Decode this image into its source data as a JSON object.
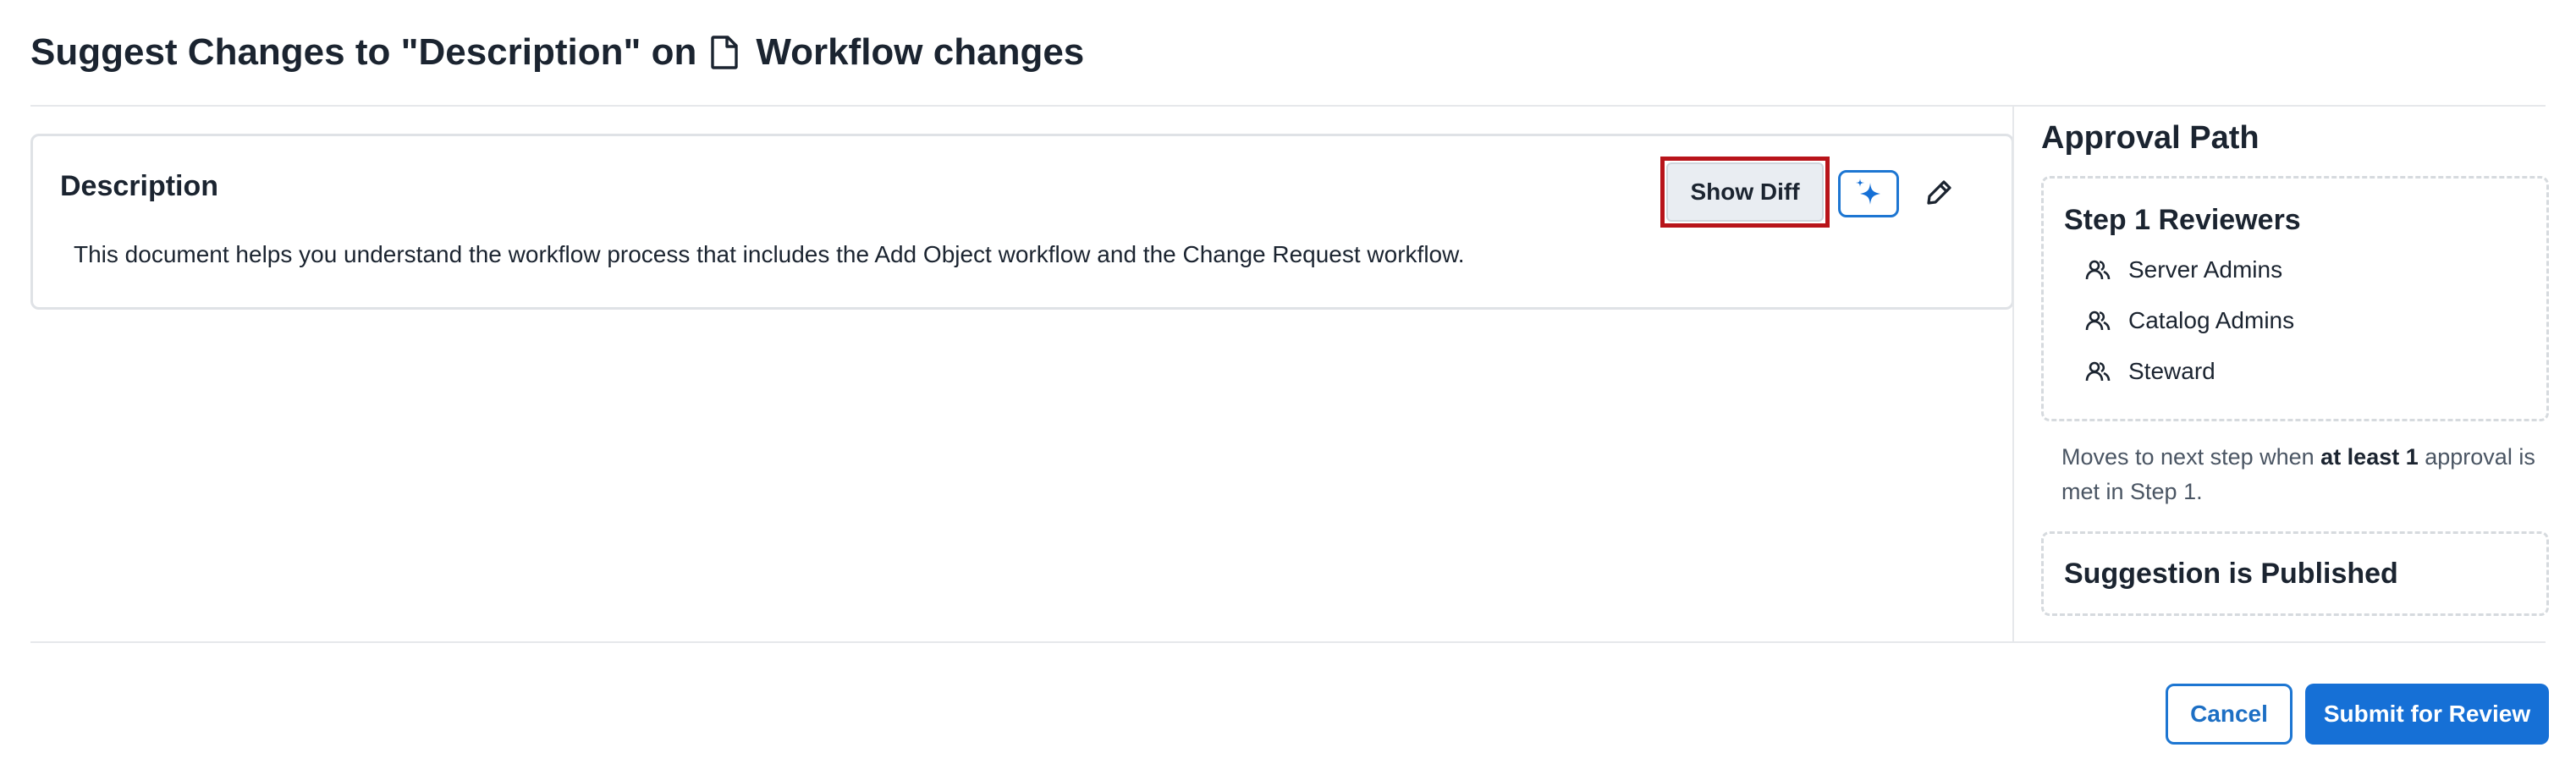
{
  "header": {
    "title_prefix": "Suggest Changes to \"Description\" on",
    "document_icon": "document-icon",
    "document_name": "Workflow changes"
  },
  "description_card": {
    "title": "Description",
    "text": "This document helps you understand the workflow process that includes the Add Object workflow and the Change Request workflow.",
    "show_diff_label": "Show Diff",
    "ai_icon": "sparkle-icon",
    "edit_icon": "pencil-icon"
  },
  "approval_path": {
    "title": "Approval Path",
    "step1": {
      "title": "Step 1 Reviewers",
      "reviewer_icon": "user-group-icon",
      "reviewers": [
        "Server Admins",
        "Catalog Admins",
        "Steward"
      ]
    },
    "note": {
      "part1": "Moves to next step when ",
      "bold": "at least 1",
      "part2": " approval is met in Step 1."
    },
    "final_step": {
      "title": "Suggestion is Published"
    }
  },
  "footer": {
    "cancel_label": "Cancel",
    "submit_label": "Submit for Review"
  },
  "colors": {
    "accent": "#1670d6",
    "highlight_border": "#b8141a"
  }
}
